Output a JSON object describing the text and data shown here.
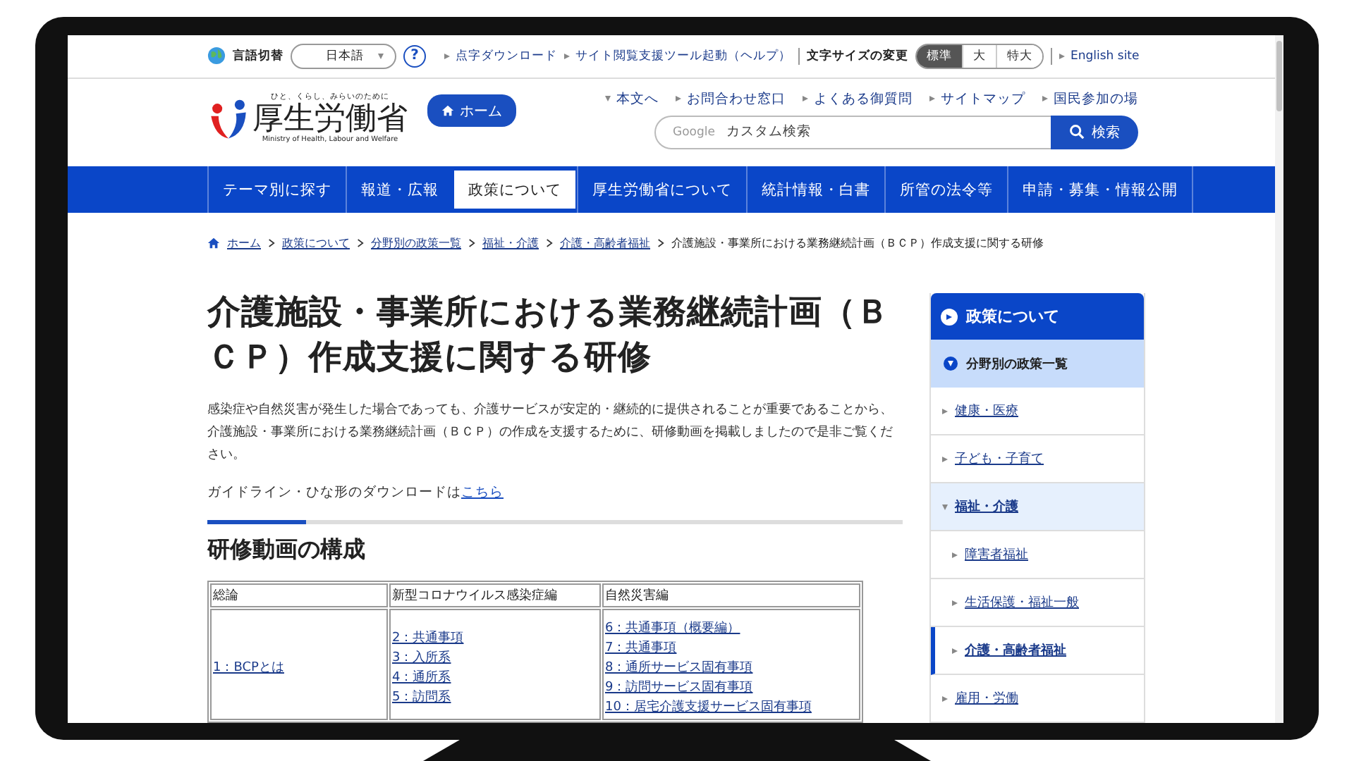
{
  "utility_bar": {
    "language_label": "言語切替",
    "language_select": "日本語",
    "help": "?",
    "links": [
      "点字ダウンロード",
      "サイト閲覧支援ツール起動（ヘルプ）"
    ],
    "font_size_label": "文字サイズの変更",
    "font_sizes": [
      {
        "label": "標準",
        "selected": true
      },
      {
        "label": "大",
        "selected": false
      },
      {
        "label": "特大",
        "selected": false
      }
    ],
    "english_link": "English site"
  },
  "header": {
    "logo_tagline": "ひと、くらし、みらいのために",
    "logo_name": "厚生労働省",
    "logo_english": "Ministry of Health, Labour and Welfare",
    "home_button": "ホーム",
    "links": [
      {
        "label": "本文へ",
        "kind": "down"
      },
      {
        "label": "お問合わせ窓口",
        "kind": "right"
      },
      {
        "label": "よくある御質問",
        "kind": "right"
      },
      {
        "label": "サイトマップ",
        "kind": "right"
      },
      {
        "label": "国民参加の場",
        "kind": "right"
      }
    ],
    "search": {
      "brand": "Google",
      "placeholder": "カスタム検索",
      "button": "検索"
    }
  },
  "nav": [
    {
      "label": "テーマ別に探す",
      "selected": false
    },
    {
      "label": "報道・広報",
      "selected": false
    },
    {
      "label": "政策について",
      "selected": true
    },
    {
      "label": "厚生労働省について",
      "selected": false
    },
    {
      "label": "統計情報・白書",
      "selected": false
    },
    {
      "label": "所管の法令等",
      "selected": false
    },
    {
      "label": "申請・募集・情報公開",
      "selected": false
    }
  ],
  "breadcrumb": [
    "ホーム",
    "政策について",
    "分野別の政策一覧",
    "福祉・介護",
    "介護・高齢者福祉",
    "介護施設・事業所における業務継続計画（ＢＣＰ）作成支援に関する研修"
  ],
  "title": "介護施設・事業所における業務継続計画（ＢＣＰ）作成支援に関する研修",
  "intro": "感染症や自然災害が発生した場合であっても、介護サービスが安定的・継続的に提供されることが重要であることから、介護施設・事業所における業務継続計画（ＢＣＰ）の作成を支援するために、研修動画を掲載しましたので是非ご覧ください。",
  "download": {
    "text": "ガイドライン・ひな形のダウンロードは",
    "link": "こちら"
  },
  "section_heading": "研修動画の構成",
  "table": {
    "columns": [
      "総論",
      "新型コロナウイルス感染症編",
      "自然災害編"
    ],
    "rows": [
      {
        "cells": [
          [
            "1：BCPとは"
          ],
          [
            "2：共通事項",
            "3：入所系",
            "4：通所系",
            "5：訪問系"
          ],
          [
            "6：共通事項（概要編）",
            "7：共通事項",
            "8：通所サービス固有事項",
            "9：訪問サービス固有事項",
            "10：居宅介護支援サービス固有事項"
          ]
        ]
      }
    ]
  },
  "sidebar": {
    "heading": "政策について",
    "subheading": "分野別の政策一覧",
    "items": [
      {
        "label": "健康・医療",
        "expanded": false,
        "selected": false
      },
      {
        "label": "子ども・子育て",
        "expanded": false,
        "selected": false
      },
      {
        "label": "福祉・介護",
        "expanded": true,
        "selected": false,
        "children": [
          {
            "label": "障害者福祉",
            "selected": false
          },
          {
            "label": "生活保護・福祉一般",
            "selected": false
          },
          {
            "label": "介護・高齢者福祉",
            "selected": true
          }
        ]
      },
      {
        "label": "雇用・労働",
        "expanded": false,
        "selected": false
      }
    ]
  }
}
